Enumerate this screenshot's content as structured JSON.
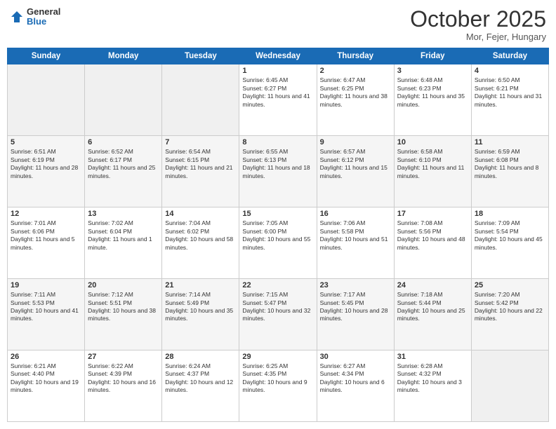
{
  "header": {
    "logo": {
      "general": "General",
      "blue": "Blue"
    },
    "title": "October 2025",
    "location": "Mor, Fejer, Hungary"
  },
  "days_of_week": [
    "Sunday",
    "Monday",
    "Tuesday",
    "Wednesday",
    "Thursday",
    "Friday",
    "Saturday"
  ],
  "weeks": [
    [
      {
        "day": "",
        "empty": true
      },
      {
        "day": "",
        "empty": true
      },
      {
        "day": "",
        "empty": true
      },
      {
        "day": "1",
        "sunrise": "6:45 AM",
        "sunset": "6:27 PM",
        "daylight": "11 hours and 41 minutes."
      },
      {
        "day": "2",
        "sunrise": "6:47 AM",
        "sunset": "6:25 PM",
        "daylight": "11 hours and 38 minutes."
      },
      {
        "day": "3",
        "sunrise": "6:48 AM",
        "sunset": "6:23 PM",
        "daylight": "11 hours and 35 minutes."
      },
      {
        "day": "4",
        "sunrise": "6:50 AM",
        "sunset": "6:21 PM",
        "daylight": "11 hours and 31 minutes."
      }
    ],
    [
      {
        "day": "5",
        "sunrise": "6:51 AM",
        "sunset": "6:19 PM",
        "daylight": "11 hours and 28 minutes."
      },
      {
        "day": "6",
        "sunrise": "6:52 AM",
        "sunset": "6:17 PM",
        "daylight": "11 hours and 25 minutes."
      },
      {
        "day": "7",
        "sunrise": "6:54 AM",
        "sunset": "6:15 PM",
        "daylight": "11 hours and 21 minutes."
      },
      {
        "day": "8",
        "sunrise": "6:55 AM",
        "sunset": "6:13 PM",
        "daylight": "11 hours and 18 minutes."
      },
      {
        "day": "9",
        "sunrise": "6:57 AM",
        "sunset": "6:12 PM",
        "daylight": "11 hours and 15 minutes."
      },
      {
        "day": "10",
        "sunrise": "6:58 AM",
        "sunset": "6:10 PM",
        "daylight": "11 hours and 11 minutes."
      },
      {
        "day": "11",
        "sunrise": "6:59 AM",
        "sunset": "6:08 PM",
        "daylight": "11 hours and 8 minutes."
      }
    ],
    [
      {
        "day": "12",
        "sunrise": "7:01 AM",
        "sunset": "6:06 PM",
        "daylight": "11 hours and 5 minutes."
      },
      {
        "day": "13",
        "sunrise": "7:02 AM",
        "sunset": "6:04 PM",
        "daylight": "11 hours and 1 minute."
      },
      {
        "day": "14",
        "sunrise": "7:04 AM",
        "sunset": "6:02 PM",
        "daylight": "10 hours and 58 minutes."
      },
      {
        "day": "15",
        "sunrise": "7:05 AM",
        "sunset": "6:00 PM",
        "daylight": "10 hours and 55 minutes."
      },
      {
        "day": "16",
        "sunrise": "7:06 AM",
        "sunset": "5:58 PM",
        "daylight": "10 hours and 51 minutes."
      },
      {
        "day": "17",
        "sunrise": "7:08 AM",
        "sunset": "5:56 PM",
        "daylight": "10 hours and 48 minutes."
      },
      {
        "day": "18",
        "sunrise": "7:09 AM",
        "sunset": "5:54 PM",
        "daylight": "10 hours and 45 minutes."
      }
    ],
    [
      {
        "day": "19",
        "sunrise": "7:11 AM",
        "sunset": "5:53 PM",
        "daylight": "10 hours and 41 minutes."
      },
      {
        "day": "20",
        "sunrise": "7:12 AM",
        "sunset": "5:51 PM",
        "daylight": "10 hours and 38 minutes."
      },
      {
        "day": "21",
        "sunrise": "7:14 AM",
        "sunset": "5:49 PM",
        "daylight": "10 hours and 35 minutes."
      },
      {
        "day": "22",
        "sunrise": "7:15 AM",
        "sunset": "5:47 PM",
        "daylight": "10 hours and 32 minutes."
      },
      {
        "day": "23",
        "sunrise": "7:17 AM",
        "sunset": "5:45 PM",
        "daylight": "10 hours and 28 minutes."
      },
      {
        "day": "24",
        "sunrise": "7:18 AM",
        "sunset": "5:44 PM",
        "daylight": "10 hours and 25 minutes."
      },
      {
        "day": "25",
        "sunrise": "7:20 AM",
        "sunset": "5:42 PM",
        "daylight": "10 hours and 22 minutes."
      }
    ],
    [
      {
        "day": "26",
        "sunrise": "6:21 AM",
        "sunset": "4:40 PM",
        "daylight": "10 hours and 19 minutes."
      },
      {
        "day": "27",
        "sunrise": "6:22 AM",
        "sunset": "4:39 PM",
        "daylight": "10 hours and 16 minutes."
      },
      {
        "day": "28",
        "sunrise": "6:24 AM",
        "sunset": "4:37 PM",
        "daylight": "10 hours and 12 minutes."
      },
      {
        "day": "29",
        "sunrise": "6:25 AM",
        "sunset": "4:35 PM",
        "daylight": "10 hours and 9 minutes."
      },
      {
        "day": "30",
        "sunrise": "6:27 AM",
        "sunset": "4:34 PM",
        "daylight": "10 hours and 6 minutes."
      },
      {
        "day": "31",
        "sunrise": "6:28 AM",
        "sunset": "4:32 PM",
        "daylight": "10 hours and 3 minutes."
      },
      {
        "day": "",
        "empty": true
      }
    ]
  ],
  "row_colors": [
    "#fff",
    "#f5f5f5",
    "#fff",
    "#f5f5f5",
    "#fff"
  ]
}
